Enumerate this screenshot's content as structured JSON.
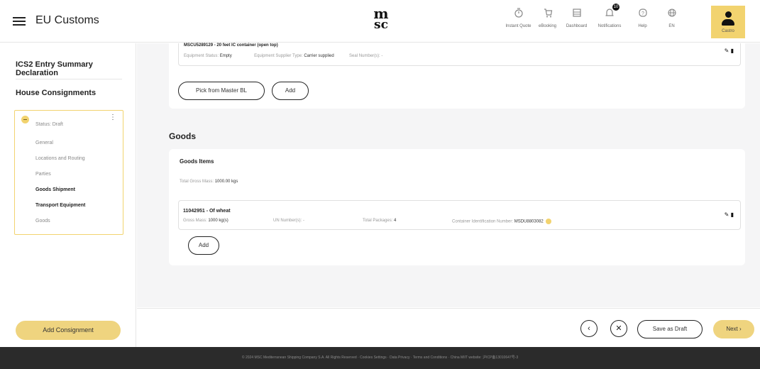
{
  "header": {
    "app_title": "EU Customs",
    "logo_line1": "m",
    "logo_line2": "sc",
    "nav": [
      {
        "label": "Instant Quote",
        "icon": "instant-quote-icon"
      },
      {
        "label": "eBooking",
        "icon": "cart-icon"
      },
      {
        "label": "Dashboard",
        "icon": "dashboard-icon"
      },
      {
        "label": "Notifications",
        "icon": "bell-icon",
        "badge": "10"
      },
      {
        "label": "Help",
        "icon": "help-icon"
      },
      {
        "label": "EN",
        "icon": "globe-icon"
      }
    ],
    "user_label": "Castro"
  },
  "sidebar": {
    "heading1": "ICS2 Entry Summary Declaration",
    "heading2": "House Consignments",
    "status": "Status: Draft",
    "menu": [
      "General",
      "Locations and Routing",
      "Parties",
      "Goods Shipment",
      "Transport Equipment",
      "Goods"
    ],
    "add_consignment": "Add Consignment"
  },
  "equipment": {
    "title": "MSCU5289129 - 20 feet IC container (open top)",
    "status_label": "Equipment Status:",
    "status_value": "Empty",
    "supplier_label": "Equipment Supplier Type:",
    "supplier_value": "Carrier supplied",
    "seal_label": "Seal Number(s): -",
    "pick_button": "Pick from Master BL",
    "add_button": "Add"
  },
  "goods": {
    "section_title": "Goods",
    "items_title": "Goods Items",
    "total_label": "Total Gross Mass:",
    "total_value": "1000.00 kgs",
    "item": {
      "title": "11042951 - Of wheat",
      "gross_label": "Gross Mass:",
      "gross_value": "1000 kg(s)",
      "un_label": "UN Number(s): -",
      "packages_label": "Total Packages:",
      "packages_value": "4",
      "container_label": "Container Identification Number:",
      "container_value": "MSDU8803082"
    },
    "add_button": "Add"
  },
  "actions": {
    "back": "‹",
    "close": "✕",
    "save_draft": "Save as Draft",
    "next": "Next ›"
  },
  "footer": {
    "text": "© 2024 MSC Mediterranean Shipping Company S.A. All Rights Reserved · Cookies Settings · Data Privacy · Terms and Conditions · China MIIT website: 沪ICP备13010647号-3"
  }
}
